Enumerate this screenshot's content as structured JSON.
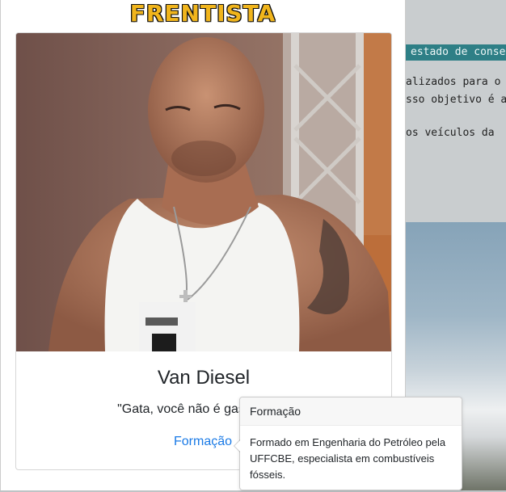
{
  "background_page": {
    "teal_bar_text": "estado de conse",
    "line1": "alizados para o",
    "line2": "sso objetivo é a",
    "line3": "os veículos da"
  },
  "modal": {
    "title": "FRENTISTA",
    "colors": {
      "title": "#f1b51c",
      "title_outline": "#111111"
    }
  },
  "card": {
    "name": "Van Diesel",
    "quote": "\"Gata, você não é gasolina, m",
    "link_label": "Formação",
    "colors": {
      "link": "#1a7ae6"
    }
  },
  "popover": {
    "header": "Formação",
    "body": "Formado em Engenharia do Petróleo pela UFFCBE, especialista em combustíveis fósseis."
  }
}
